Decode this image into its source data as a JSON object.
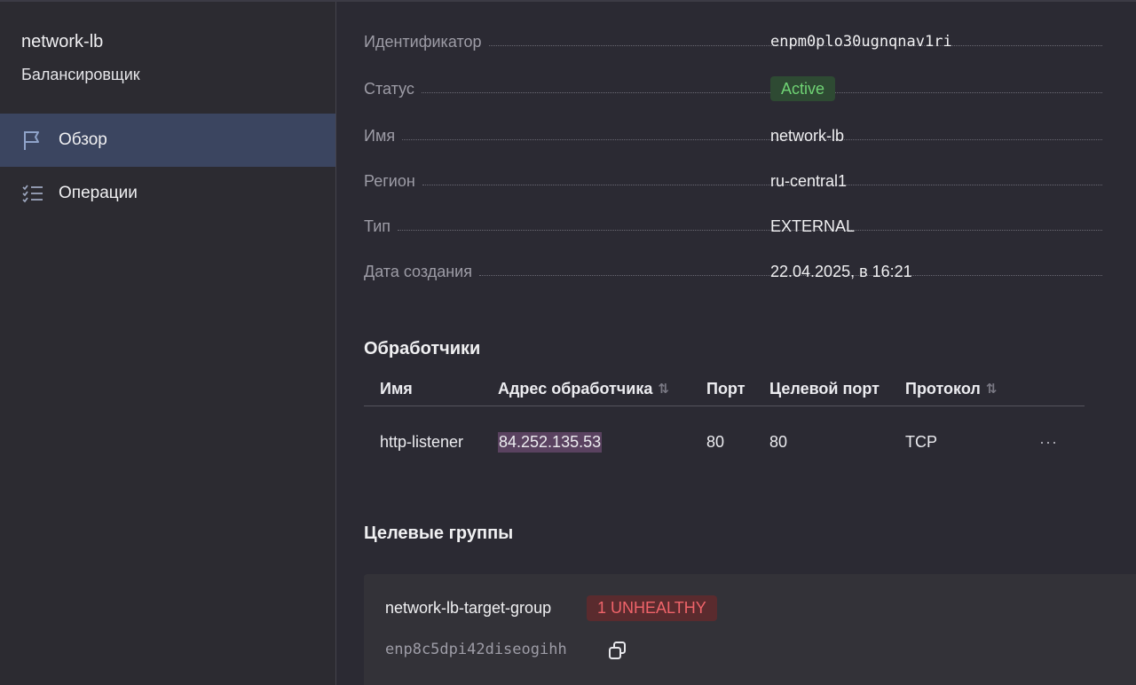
{
  "sidebar": {
    "title": "network-lb",
    "subtitle": "Балансировщик",
    "items": [
      {
        "label": "Обзор",
        "icon": "flag-icon",
        "active": true
      },
      {
        "label": "Операции",
        "icon": "checklist-icon",
        "active": false
      }
    ]
  },
  "properties": [
    {
      "label": "Идентификатор",
      "value": "enpm0plo30ugnqnav1ri"
    },
    {
      "label": "Статус",
      "value": "Active"
    },
    {
      "label": "Имя",
      "value": "network-lb"
    },
    {
      "label": "Регион",
      "value": "ru-central1"
    },
    {
      "label": "Тип",
      "value": "EXTERNAL"
    },
    {
      "label": "Дата создания",
      "value": "22.04.2025, в 16:21"
    }
  ],
  "listeners": {
    "title": "Обработчики",
    "columns": [
      "Имя",
      "Адрес обработчика",
      "Порт",
      "Целевой порт",
      "Протокол"
    ],
    "rows": [
      {
        "name": "http-listener",
        "address": "84.252.135.53",
        "port": "80",
        "target_port": "80",
        "protocol": "TCP",
        "more": "···"
      }
    ]
  },
  "target_groups": {
    "title": "Целевые группы",
    "items": [
      {
        "name": "network-lb-target-group",
        "status": "1 UNHEALTHY",
        "id": "enp8c5dpi42diseogihh"
      }
    ]
  },
  "colors": {
    "background": "#2b2a33",
    "sidebar_active": "#3b4560",
    "status_active": "#6fd374",
    "status_unhealthy": "#f0646a"
  }
}
